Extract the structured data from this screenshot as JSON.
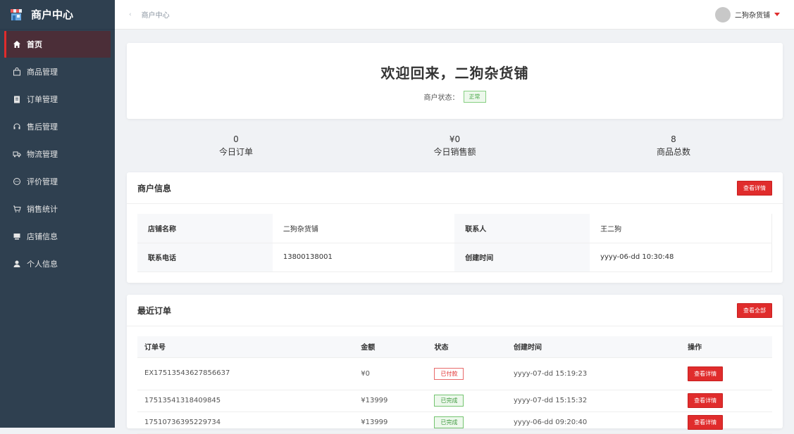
{
  "sidebar": {
    "title": "商户中心",
    "items": [
      {
        "label": "首页",
        "icon": "home-icon",
        "active": true
      },
      {
        "label": "商品管理",
        "icon": "bag-icon"
      },
      {
        "label": "订单管理",
        "icon": "clipboard-icon"
      },
      {
        "label": "售后管理",
        "icon": "headset-icon"
      },
      {
        "label": "物流管理",
        "icon": "truck-icon"
      },
      {
        "label": "评价管理",
        "icon": "comment-icon"
      },
      {
        "label": "销售统计",
        "icon": "cart-icon"
      },
      {
        "label": "店铺信息",
        "icon": "store-icon"
      },
      {
        "label": "个人信息",
        "icon": "user-icon"
      }
    ]
  },
  "header": {
    "breadcrumb": "商户中心",
    "user_name": "二狗杂货铺"
  },
  "welcome": {
    "title": "欢迎回来，二狗杂货铺",
    "status_label": "商户状态：",
    "status_value": "正常"
  },
  "stats": [
    {
      "value": "0",
      "label": "今日订单"
    },
    {
      "value": "¥0",
      "label": "今日销售额"
    },
    {
      "value": "8",
      "label": "商品总数"
    }
  ],
  "merchant_info": {
    "title": "商户信息",
    "button": "查看详情",
    "rows": [
      {
        "label1": "店铺名称",
        "value1": "二狗杂货铺",
        "label2": "联系人",
        "value2": "王二狗"
      },
      {
        "label1": "联系电话",
        "value1": "13800138001",
        "label2": "创建时间",
        "value2": "yyyy-06-dd 10:30:48"
      }
    ]
  },
  "recent_orders": {
    "title": "最近订单",
    "button": "查看全部",
    "columns": [
      "订单号",
      "金额",
      "状态",
      "创建时间",
      "操作"
    ],
    "rows": [
      {
        "order_no": "EX17513543627856637",
        "amount": "¥0",
        "status": "已付款",
        "status_type": "paid",
        "created": "yyyy-07-dd 15:19:23",
        "action": "查看详情"
      },
      {
        "order_no": "17513541318409845",
        "amount": "¥13999",
        "status": "已完成",
        "status_type": "done",
        "created": "yyyy-07-dd 15:15:32",
        "action": "查看详情"
      },
      {
        "order_no": "17510736395229734",
        "amount": "¥13999",
        "status": "已完成",
        "status_type": "done",
        "created": "yyyy-06-dd 09:20:40",
        "action": "查看详情"
      }
    ]
  },
  "colors": {
    "sidebar_bg": "#2f4050",
    "accent_red": "#e02c2c",
    "status_green": "#4aa94a"
  }
}
